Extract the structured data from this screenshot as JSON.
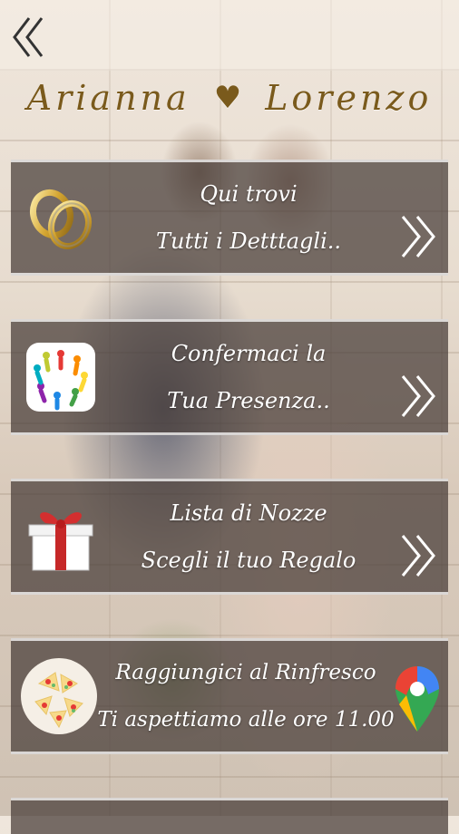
{
  "header": {
    "back_icon": "double-chevron-left-icon",
    "name_left": "Arianna",
    "heart": "♥",
    "name_right": "Lorenzo"
  },
  "menu": [
    {
      "line1": "Qui trovi",
      "line2": "Tutti i Detttagli..",
      "icon": "wedding-rings-icon",
      "chevron": "double-chevron-right-icon"
    },
    {
      "line1": "Confermaci la",
      "line2": "Tua Presenza..",
      "icon": "people-circle-icon",
      "chevron": "double-chevron-right-icon"
    },
    {
      "line1": "Lista di Nozze",
      "line2": "Scegli il tuo Regalo",
      "icon": "gift-box-icon",
      "chevron": "double-chevron-right-icon"
    },
    {
      "line1": "Raggiungici al Rinfresco",
      "line2": "Ti aspettiamo alle ore 11.00",
      "icon": "food-plate-icon",
      "trailing": "google-maps-pin-icon"
    }
  ],
  "colors": {
    "title_gold": "#7a5a1c",
    "card_bg": "#463c37",
    "text_white": "#ffffff"
  }
}
